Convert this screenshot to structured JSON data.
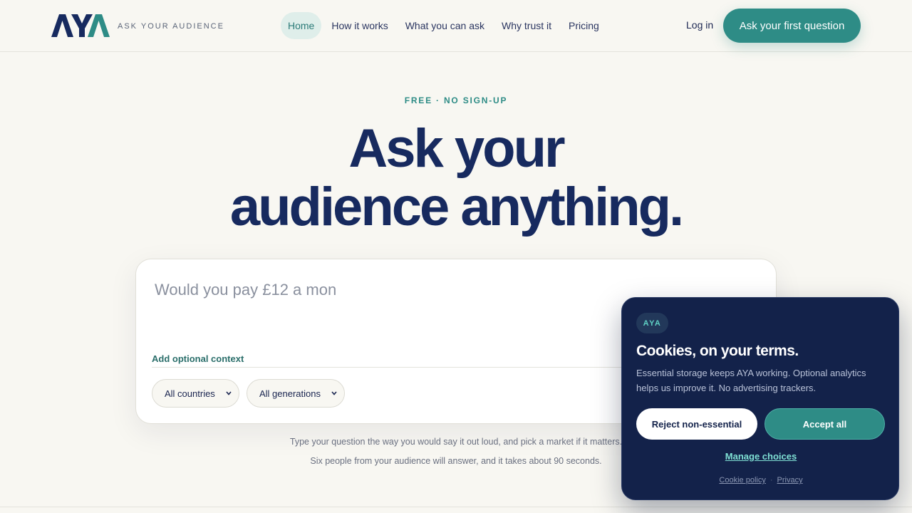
{
  "brand": {
    "logo_text": "AYA",
    "tagline": "ASK YOUR AUDIENCE",
    "colors": {
      "navy": "#172a5f",
      "teal": "#2e8c86",
      "background": "#f8f7f2"
    }
  },
  "nav": {
    "items": [
      {
        "label": "Home",
        "active": true
      },
      {
        "label": "How it works",
        "active": false
      },
      {
        "label": "What you can ask",
        "active": false
      },
      {
        "label": "Why trust it",
        "active": false
      },
      {
        "label": "Pricing",
        "active": false
      }
    ],
    "login_label": "Log in",
    "cta_label": "Ask your first question"
  },
  "hero": {
    "eyebrow": "FREE · NO SIGN-UP",
    "headline_line1": "Ask your",
    "headline_line2": "audience anything."
  },
  "question_card": {
    "input_value": "",
    "input_placeholder": "Would you pay £12 a mon",
    "context_link": "Add optional context",
    "country_select": {
      "selected": "All countries",
      "icon": "chevron-down-icon"
    },
    "generation_select": {
      "selected": "All generations",
      "icon": "chevron-down-icon"
    }
  },
  "helper": {
    "line1": "Type your question the way you would say it out loud, and pick a market if it matters.",
    "line2": "Six people from your audience will answer, and it takes about 90 seconds."
  },
  "cookie_banner": {
    "badge": "AYA",
    "title": "Cookies, on your terms.",
    "body": "Essential storage keeps AYA working. Optional analytics helps us improve it. No advertising trackers.",
    "reject_label": "Reject non-essential",
    "accept_label": "Accept all",
    "manage_label": "Manage choices",
    "links": [
      "Cookie policy",
      "Privacy"
    ]
  }
}
